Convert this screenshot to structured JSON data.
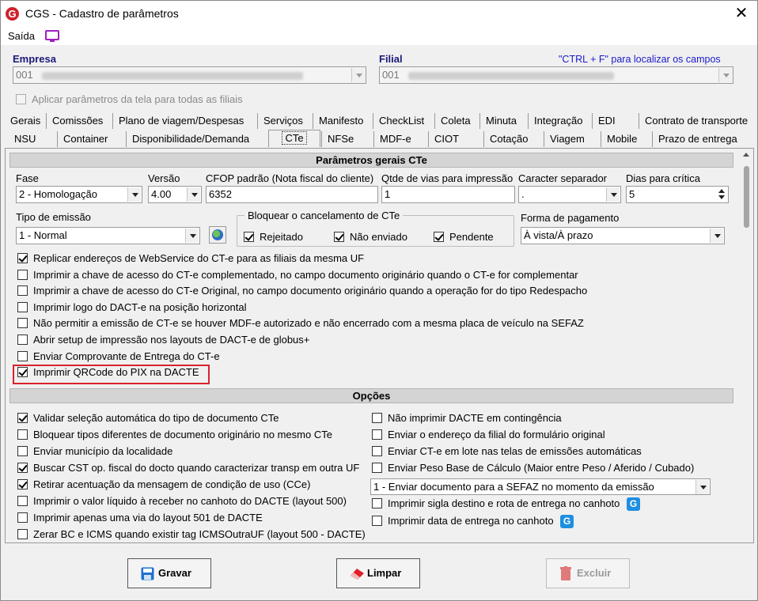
{
  "window": {
    "title": "CGS - Cadastro de parâmetros",
    "close_glyph": "✕",
    "logo_letter": "G"
  },
  "menu": {
    "saida": "Saída"
  },
  "empresa": {
    "label": "Empresa",
    "value_prefix": "001"
  },
  "filial": {
    "label": "Filial",
    "value_prefix": "001",
    "hint": "\"CTRL + F\" para localizar os campos"
  },
  "aplicar_todas": {
    "label": "Aplicar parâmetros da tela para todas as filiais",
    "checked": false
  },
  "tabs_row1": [
    "Gerais",
    "Comissões",
    "Plano de viagem/Despesas",
    "Serviços",
    "Manifesto",
    "CheckList",
    "Coleta",
    "Minuta",
    "Integração",
    "EDI",
    "Contrato de transporte"
  ],
  "tabs_row2": [
    "NSU",
    "Container",
    "Disponibilidade/Demanda",
    "CTe",
    "NFSe",
    "MDF-e",
    "CIOT",
    "Cotação",
    "Viagem",
    "Mobile",
    "Prazo de entrega"
  ],
  "selected_tab": "CTe",
  "section_gerais": {
    "title": "Parâmetros gerais CTe"
  },
  "fields": {
    "fase_label": "Fase",
    "fase_value": "2 - Homologação",
    "versao_label": "Versão",
    "versao_value": "4.00",
    "cfop_label": "CFOP padrão (Nota fiscal do cliente)",
    "cfop_value": "6352",
    "qtde_vias_label": "Qtde de vias para impressão",
    "qtde_vias_value": "1",
    "separador_label": "Caracter separador",
    "separador_value": ".",
    "dias_critica_label": "Dias para crítica",
    "dias_critica_value": "5",
    "tipo_emissao_label": "Tipo de emissão",
    "tipo_emissao_value": "1 - Normal",
    "forma_pagamento_label": "Forma de pagamento",
    "forma_pagamento_value": "À vista/À prazo"
  },
  "bloquear_cancelamento": {
    "title": "Bloquear o cancelamento de CTe",
    "rejeitado": "Rejeitado",
    "nao_enviado": "Não enviado",
    "pendente": "Pendente"
  },
  "gerais_checks": [
    {
      "label": "Replicar endereços de WebService do CT-e para as filiais da mesma UF",
      "checked": true
    },
    {
      "label": "Imprimir a chave de acesso do CT-e complementado, no campo documento originário quando o CT-e for complementar",
      "checked": false
    },
    {
      "label": "Imprimir a chave de acesso do CT-e Original, no campo documento originário quando a operação for do tipo Redespacho",
      "checked": false
    },
    {
      "label": "Imprimir logo do DACT-e na posição horizontal",
      "checked": false
    },
    {
      "label": "Não permitir a emissão de CT-e se houver MDF-e autorizado e não encerrado com a mesma placa de veículo na SEFAZ",
      "checked": false
    },
    {
      "label": "Abrir setup de impressão nos layouts de DACT-e de globus+",
      "checked": false
    },
    {
      "label": "Enviar Comprovante de Entrega do CT-e",
      "checked": false
    },
    {
      "label": "Imprimir QRCode do PIX na DACTE",
      "checked": true
    }
  ],
  "section_opcoes": {
    "title": "Opções"
  },
  "opcoes_left": [
    {
      "label": "Validar seleção automática do tipo de documento CTe",
      "checked": true
    },
    {
      "label": "Bloquear tipos diferentes de documento originário no mesmo CTe",
      "checked": false
    },
    {
      "label": "Enviar município da localidade",
      "checked": false
    },
    {
      "label": "Buscar CST op. fiscal do docto quando caracterizar transp em outra UF",
      "checked": true
    },
    {
      "label": "Retirar acentuação da mensagem de condição de uso (CCe)",
      "checked": true
    },
    {
      "label": "Imprimir o valor líquido à receber no canhoto do DACTE (layout 500)",
      "checked": false
    },
    {
      "label": "Imprimir apenas uma via do layout 501 de DACTE",
      "checked": false
    },
    {
      "label": "Zerar BC e ICMS quando existir tag ICMSOutraUF (layout 500 - DACTE)",
      "checked": false
    }
  ],
  "opcoes_right": [
    {
      "label": "Não imprimir DACTE em contingência",
      "checked": false
    },
    {
      "label": "Enviar o endereço da filial do formulário original",
      "checked": false
    },
    {
      "label": "Enviar CT-e em lote nas telas de emissões automáticas",
      "checked": false
    },
    {
      "label": "Enviar Peso Base de Cálculo (Maior entre Peso / Aferido / Cubado)",
      "checked": false
    }
  ],
  "envio_select": {
    "value": "1 - Enviar documento para a SEFAZ no momento da emissão"
  },
  "opcoes_right_bottom": [
    {
      "label": "Imprimir sigla destino e rota de entrega no canhoto",
      "checked": false
    },
    {
      "label": "Imprimir data de entrega no canhoto",
      "checked": false
    }
  ],
  "buttons": {
    "gravar": "Gravar",
    "limpar": "Limpar",
    "excluir": "Excluir"
  },
  "colors": {
    "highlight": "#d8232a",
    "label_blue": "#1a1a7a",
    "hint_blue": "#1a1acc",
    "logo_red": "#d0202a",
    "saida_icon": "#a020c0"
  }
}
